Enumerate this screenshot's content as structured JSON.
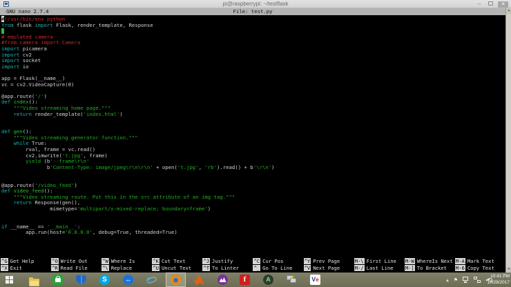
{
  "window": {
    "title": "pi@raspberrypi: ~/testflask",
    "controls": {
      "minimize": "–",
      "close": "✕"
    }
  },
  "nano": {
    "version_label": "GNU nano 2.7.4",
    "file_label": "File: test.py",
    "shortcut_rows": [
      [
        {
          "key": "^G",
          "label": "Get Help"
        },
        {
          "key": "^O",
          "label": "Write Out"
        },
        {
          "key": "^W",
          "label": "Where Is"
        },
        {
          "key": "^K",
          "label": "Cut Text"
        },
        {
          "key": "^J",
          "label": "Justify"
        },
        {
          "key": "^C",
          "label": "Cur Pos"
        },
        {
          "key": "^Y",
          "label": "Prev Page"
        },
        {
          "key": "M-\\",
          "label": "First Line"
        },
        {
          "key": "M-W",
          "label": "WhereIs Next"
        },
        {
          "key": "M-A",
          "label": "Mark Text"
        }
      ],
      [
        {
          "key": "^X",
          "label": "Exit"
        },
        {
          "key": "^R",
          "label": "Read File"
        },
        {
          "key": "^\\",
          "label": "Replace"
        },
        {
          "key": "^U",
          "label": "Uncut Text"
        },
        {
          "key": "^T",
          "label": "To Linter"
        },
        {
          "key": "^_",
          "label": "Go To Line"
        },
        {
          "key": "^V",
          "label": "Next Page"
        },
        {
          "key": "M-/",
          "label": "Last Line"
        },
        {
          "key": "M-]",
          "label": "To Bracket"
        },
        {
          "key": "M-6",
          "label": "Copy Text"
        }
      ]
    ]
  },
  "code": {
    "lines": [
      [
        [
          "h",
          "#"
        ],
        [
          "c",
          "!/usr/bin/env python"
        ]
      ],
      [
        [
          "k",
          "from"
        ],
        [
          "w",
          " flask "
        ],
        [
          "k",
          "import"
        ],
        [
          "w",
          " Flask, render_template, Response"
        ]
      ],
      [
        [
          "cur",
          " "
        ]
      ],
      [
        [
          "c",
          "# emulated camera"
        ]
      ],
      [
        [
          "c",
          "#from camera import Camera"
        ]
      ],
      [
        [
          "k",
          "import"
        ],
        [
          "w",
          " picamera"
        ]
      ],
      [
        [
          "k",
          "import"
        ],
        [
          "w",
          " cv2"
        ]
      ],
      [
        [
          "k",
          "import"
        ],
        [
          "w",
          " socket"
        ]
      ],
      [
        [
          "k",
          "import"
        ],
        [
          "w",
          " io"
        ]
      ],
      [],
      [
        [
          "w",
          "app = Flask(__name__)"
        ]
      ],
      [
        [
          "w",
          "vc = cv2.VideoCapture(0)"
        ]
      ],
      [],
      [
        [
          "w",
          "@app.route("
        ],
        [
          "s",
          "'/'"
        ],
        [
          "w",
          ")"
        ]
      ],
      [
        [
          "k",
          "def"
        ],
        [
          "w",
          " "
        ],
        [
          "f",
          "index"
        ],
        [
          "w",
          "():"
        ]
      ],
      [
        [
          "w",
          "    "
        ],
        [
          "s",
          "\"\"\"Video streaming home page.\"\"\""
        ]
      ],
      [
        [
          "w",
          "    "
        ],
        [
          "k",
          "return"
        ],
        [
          "w",
          " render_template("
        ],
        [
          "s",
          "'index.html'"
        ],
        [
          "w",
          ")"
        ]
      ],
      [],
      [],
      [
        [
          "k",
          "def"
        ],
        [
          "w",
          " "
        ],
        [
          "f",
          "gen"
        ],
        [
          "w",
          "():"
        ]
      ],
      [
        [
          "w",
          "    "
        ],
        [
          "s",
          "\"\"\"Video streaming generator function.\"\"\""
        ]
      ],
      [
        [
          "w",
          "    "
        ],
        [
          "k",
          "while"
        ],
        [
          "w",
          " True:"
        ]
      ],
      [
        [
          "w",
          "        rval, frame = vc.read()"
        ]
      ],
      [
        [
          "w",
          "        cv2.imwrite("
        ],
        [
          "s",
          "'t.jpg'"
        ],
        [
          "w",
          ", frame)"
        ]
      ],
      [
        [
          "w",
          "        "
        ],
        [
          "s",
          "yield"
        ],
        [
          "w",
          " (b"
        ],
        [
          "s",
          "'--frame\\r\\n'"
        ]
      ],
      [
        [
          "w",
          "               b"
        ],
        [
          "s",
          "'Content-Type: image/jpeg\\r\\n\\r\\n'"
        ],
        [
          "w",
          " + open("
        ],
        [
          "s",
          "'t.jpg'"
        ],
        [
          "w",
          ", "
        ],
        [
          "s",
          "'rb'"
        ],
        [
          "w",
          ").read() + b"
        ],
        [
          "s",
          "'\\r\\n'"
        ],
        [
          "w",
          ")"
        ]
      ],
      [],
      [],
      [
        [
          "w",
          "@app.route("
        ],
        [
          "s",
          "'/video_feed'"
        ],
        [
          "w",
          ")"
        ]
      ],
      [
        [
          "k",
          "def"
        ],
        [
          "w",
          " "
        ],
        [
          "f",
          "video_feed"
        ],
        [
          "w",
          "():"
        ]
      ],
      [
        [
          "w",
          "    "
        ],
        [
          "s",
          "\"\"\"Video streaming route. Put this in the src attribute of an img tag.\"\"\""
        ]
      ],
      [
        [
          "w",
          "    "
        ],
        [
          "k",
          "return"
        ],
        [
          "w",
          " Response(gen(),"
        ]
      ],
      [
        [
          "w",
          "                mimetype="
        ],
        [
          "s",
          "'multipart/x-mixed-replace; boundary=frame'"
        ],
        [
          "w",
          ")"
        ]
      ],
      [],
      [],
      [
        [
          "k",
          "if"
        ],
        [
          "w",
          " __name__ == "
        ],
        [
          "s",
          "'__main__'"
        ],
        [
          "w",
          ":"
        ]
      ],
      [
        [
          "w",
          "        app.run(host="
        ],
        [
          "s",
          "'0.0.0.0'"
        ],
        [
          "w",
          ", debug=True, threaded=True)"
        ]
      ]
    ]
  },
  "scrollbar": {
    "up_glyph": "▲",
    "down_glyph": "▼"
  },
  "taskbar": {
    "glyphs": {
      "skype": "S",
      "teamviewer": "↔",
      "ie": "e",
      "red_f": "f",
      "android": "A",
      "vnc_v": "V",
      "vnc_e": "e",
      "tray_caret": "▴",
      "tray_flag": "⚑"
    },
    "clock": {
      "time": "10:41 PM",
      "date": "10/28/2017"
    }
  },
  "palette": {
    "terminal_bg": "#000000",
    "keyword": "#1fb0b0",
    "string": "#23b023",
    "function_name": "#2cc42c",
    "comment": "#cc2a2a",
    "default_text": "#d4d4d4",
    "cursor": "#2fbf2f",
    "nano_bar": "#b4b4b4",
    "titlebar": "#d9d9d9",
    "taskbar": "#76765c"
  }
}
